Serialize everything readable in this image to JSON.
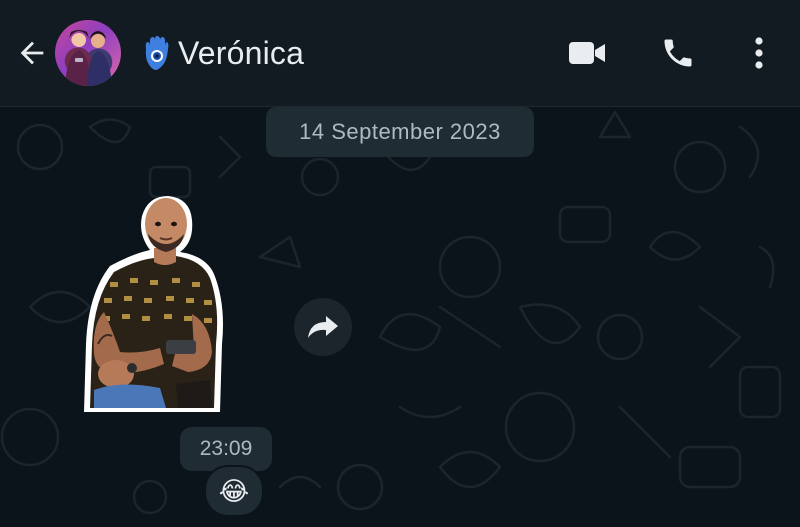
{
  "header": {
    "back_icon": "arrow-left-icon",
    "avatar_icon": "contact-avatar",
    "status_emoji_icon": "hamsa-hand-icon",
    "contact_name": "Verónica",
    "video_icon": "video-camera-icon",
    "call_icon": "phone-icon",
    "menu_icon": "more-vertical-icon"
  },
  "chat": {
    "date_separator": "14 September 2023",
    "message": {
      "type": "sticker",
      "sticker_icon": "man-holding-phone-sticker",
      "time": "23:09",
      "reaction": "😂",
      "forward_icon": "forward-arrow-icon"
    }
  },
  "colors": {
    "header_bg": "#111b21",
    "chat_bg": "#0b141a",
    "chip_bg": "#1f2c34",
    "text_primary": "#e9edef",
    "text_secondary": "#aebac1"
  }
}
